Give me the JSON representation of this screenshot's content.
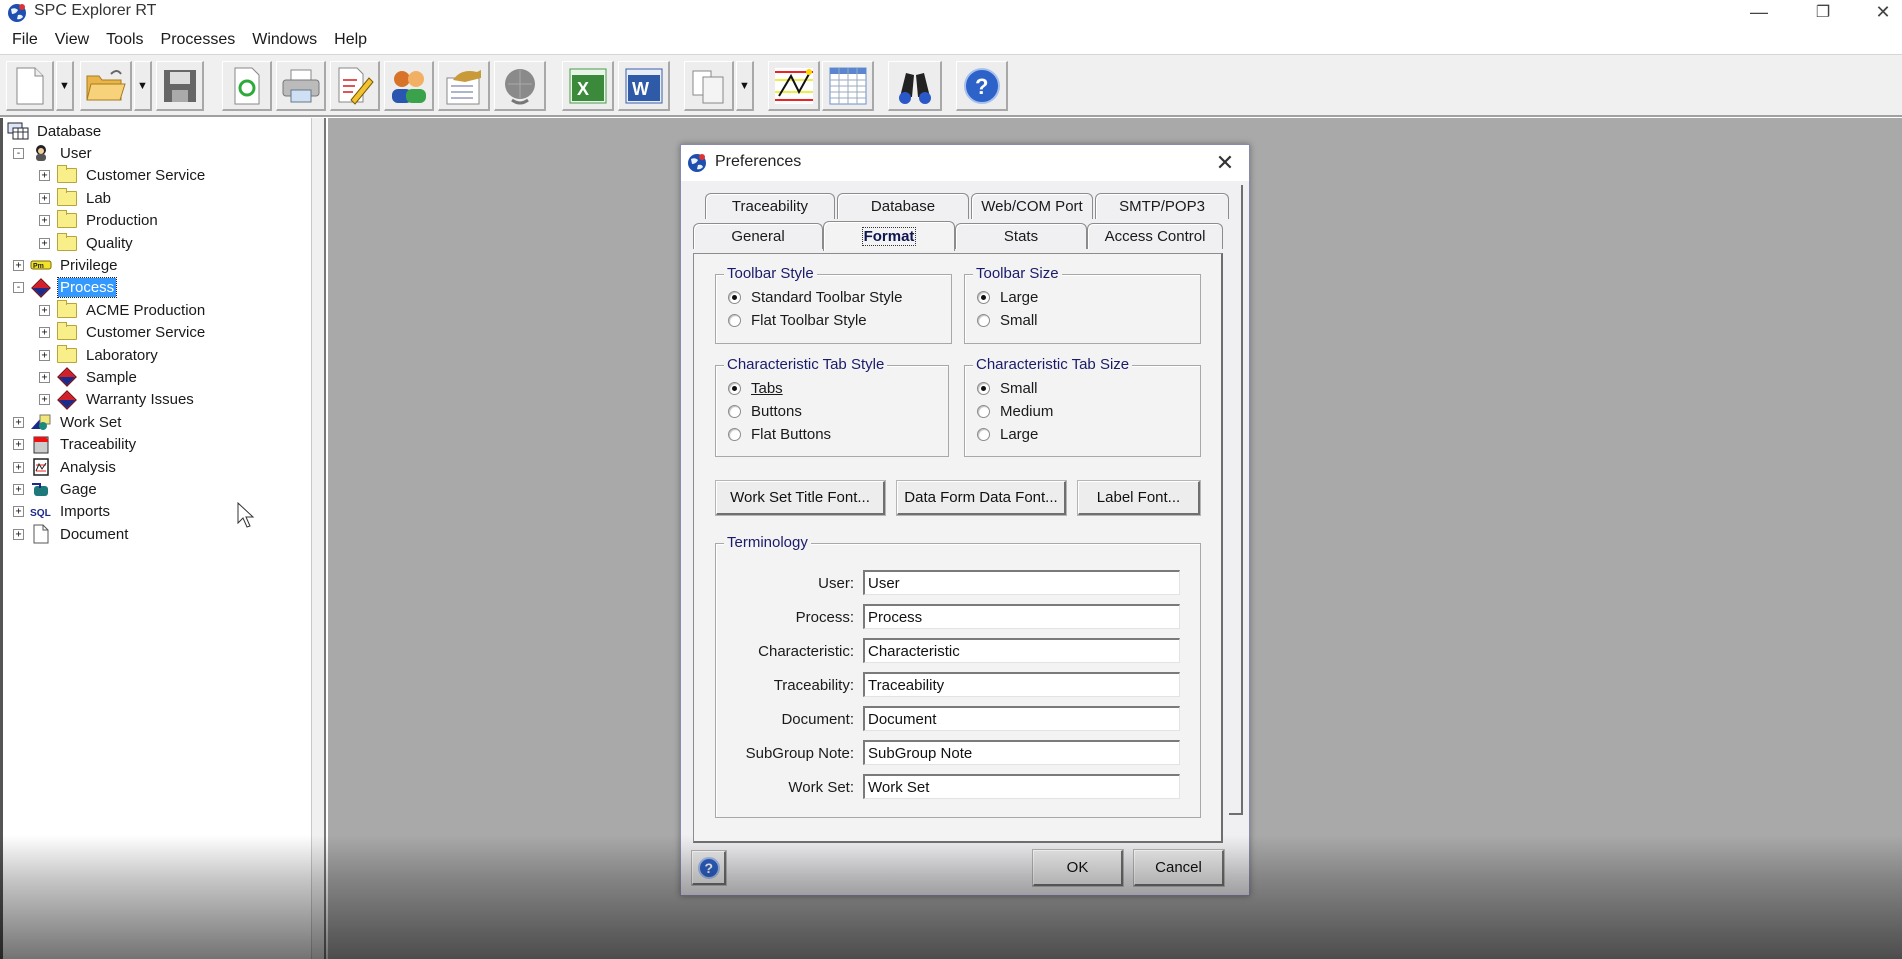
{
  "window": {
    "title": "SPC Explorer RT",
    "app_icon": "globe-icon",
    "controls": [
      {
        "name": "minimize-button",
        "glyph": "—"
      },
      {
        "name": "restore-button",
        "glyph": "❐"
      },
      {
        "name": "close-button",
        "glyph": "✕"
      }
    ]
  },
  "menu": {
    "items": [
      "File",
      "View",
      "Tools",
      "Processes",
      "Windows",
      "Help"
    ]
  },
  "toolbar": {
    "buttons": [
      {
        "icon": "new-document-icon",
        "has_dropdown": true
      },
      {
        "icon": "open-folder-icon",
        "has_dropdown": true
      },
      {
        "icon": "save-icon",
        "has_dropdown": false
      },
      {
        "icon": "refresh-document-icon",
        "has_dropdown": false
      },
      {
        "icon": "print-icon",
        "has_dropdown": false
      },
      {
        "icon": "edit-document-icon",
        "has_dropdown": false
      },
      {
        "icon": "users-icon",
        "has_dropdown": false
      },
      {
        "icon": "report-hand-icon",
        "has_dropdown": false
      },
      {
        "icon": "web-globe-icon",
        "has_dropdown": false
      },
      {
        "icon": "excel-icon",
        "has_dropdown": false
      },
      {
        "icon": "word-icon",
        "has_dropdown": false
      },
      {
        "icon": "copy-pages-icon",
        "has_dropdown": true
      },
      {
        "icon": "control-chart-icon",
        "has_dropdown": false
      },
      {
        "icon": "data-grid-icon",
        "has_dropdown": false
      },
      {
        "icon": "binoculars-icon",
        "has_dropdown": false
      },
      {
        "icon": "help-icon",
        "has_dropdown": false
      }
    ]
  },
  "tree": {
    "root": {
      "label": "Database",
      "icon": "database-icon"
    },
    "items": [
      {
        "label": "User",
        "icon": "user-icon",
        "level": 1,
        "expander": "-"
      },
      {
        "label": "Customer Service",
        "icon": "folder-icon",
        "level": 2,
        "expander": "+"
      },
      {
        "label": "Lab",
        "icon": "folder-icon",
        "level": 2,
        "expander": "+"
      },
      {
        "label": "Production",
        "icon": "folder-icon",
        "level": 2,
        "expander": "+"
      },
      {
        "label": "Quality",
        "icon": "folder-icon",
        "level": 2,
        "expander": "+"
      },
      {
        "label": "Privilege",
        "icon": "key-icon",
        "level": 1,
        "expander": "+"
      },
      {
        "label": "Process",
        "icon": "process-diamond-icon",
        "level": 1,
        "expander": "-",
        "selected": true
      },
      {
        "label": "ACME Production",
        "icon": "folder-icon",
        "level": 2,
        "expander": "+"
      },
      {
        "label": "Customer Service",
        "icon": "folder-icon",
        "level": 2,
        "expander": "+"
      },
      {
        "label": "Laboratory",
        "icon": "folder-icon",
        "level": 2,
        "expander": "+"
      },
      {
        "label": "Sample",
        "icon": "process-diamond-icon",
        "level": 2,
        "expander": "+"
      },
      {
        "label": "Warranty Issues",
        "icon": "process-diamond-icon",
        "level": 2,
        "expander": "+"
      },
      {
        "label": "Work Set",
        "icon": "work-set-icon",
        "level": 1,
        "expander": "+"
      },
      {
        "label": "Traceability",
        "icon": "traceability-icon",
        "level": 1,
        "expander": "+"
      },
      {
        "label": "Analysis",
        "icon": "analysis-chart-icon",
        "level": 1,
        "expander": "+"
      },
      {
        "label": "Gage",
        "icon": "gage-icon",
        "level": 1,
        "expander": "+"
      },
      {
        "label": "Imports",
        "icon": "sql-icon",
        "level": 1,
        "expander": "+"
      },
      {
        "label": "Document",
        "icon": "document-icon",
        "level": 1,
        "expander": "+"
      }
    ]
  },
  "dialog": {
    "title": "Preferences",
    "tabs_row_back": [
      "Traceability",
      "Database",
      "Web/COM Port",
      "SMTP/POP3"
    ],
    "tabs_row_front": [
      "General",
      "Format",
      "Stats",
      "Access Control"
    ],
    "active_tab": "Format",
    "toolbar_style": {
      "legend": "Toolbar Style",
      "options": [
        "Standard Toolbar Style",
        "Flat Toolbar Style"
      ],
      "selected": "Standard Toolbar Style"
    },
    "toolbar_size": {
      "legend": "Toolbar Size",
      "options": [
        "Large",
        "Small"
      ],
      "selected": "Large"
    },
    "char_tab_style": {
      "legend": "Characteristic Tab Style",
      "options": [
        "Tabs",
        "Buttons",
        "Flat Buttons"
      ],
      "selected": "Tabs"
    },
    "char_tab_size": {
      "legend": "Characteristic Tab Size",
      "options": [
        "Small",
        "Medium",
        "Large"
      ],
      "selected": "Small"
    },
    "font_buttons": [
      "Work Set Title Font...",
      "Data Form Data Font...",
      "Label Font..."
    ],
    "terminology": {
      "legend": "Terminology",
      "fields": [
        {
          "label": "User:",
          "value": "User"
        },
        {
          "label": "Process:",
          "value": "Process"
        },
        {
          "label": "Characteristic:",
          "value": "Characteristic"
        },
        {
          "label": "Traceability:",
          "value": "Traceability"
        },
        {
          "label": "Document:",
          "value": "Document"
        },
        {
          "label": "SubGroup Note:",
          "value": "SubGroup Note"
        },
        {
          "label": "Work Set:",
          "value": "Work Set"
        }
      ]
    },
    "ok_label": "OK",
    "cancel_label": "Cancel"
  },
  "colors": {
    "selection": "#3399ff",
    "workspace": "#a9a9a9",
    "legend_text": "#1b1b6b",
    "active_tab_text": "#0f1650"
  }
}
